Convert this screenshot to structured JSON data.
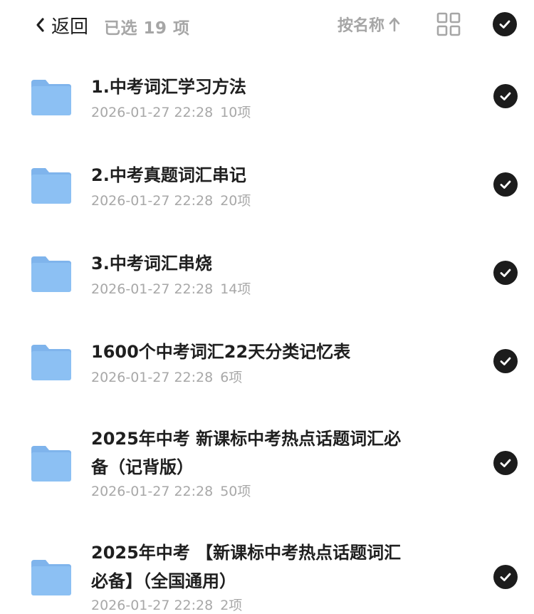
{
  "header": {
    "back_label": "返回",
    "selected_text": "已选 19 项",
    "sort_label": "按名称"
  },
  "files": [
    {
      "title": "1.中考词汇学习方法",
      "date": "2026-01-27 22:28",
      "count": "10项",
      "selected": true
    },
    {
      "title": "2.中考真题词汇串记",
      "date": "2026-01-27 22:28",
      "count": "20项",
      "selected": true
    },
    {
      "title": "3.中考词汇串烧",
      "date": "2026-01-27 22:28",
      "count": "14项",
      "selected": true
    },
    {
      "title": "1600个中考词汇22天分类记忆表",
      "date": "2026-01-27 22:28",
      "count": "6项",
      "selected": true
    },
    {
      "title": "2025年中考 新课标中考热点话题词汇必备（记背版）",
      "date": "2026-01-27 22:28",
      "count": "50项",
      "selected": true
    },
    {
      "title": "2025年中考 【新课标中考热点话题词汇必备】（全国通用）",
      "date": "2026-01-27 22:28",
      "count": "2项",
      "selected": true
    }
  ],
  "colors": {
    "folder": "#8cc0f3",
    "folder_tab": "#7fb4ec",
    "check_bg": "#1c1c1c",
    "muted_text": "#a6a6a6"
  }
}
